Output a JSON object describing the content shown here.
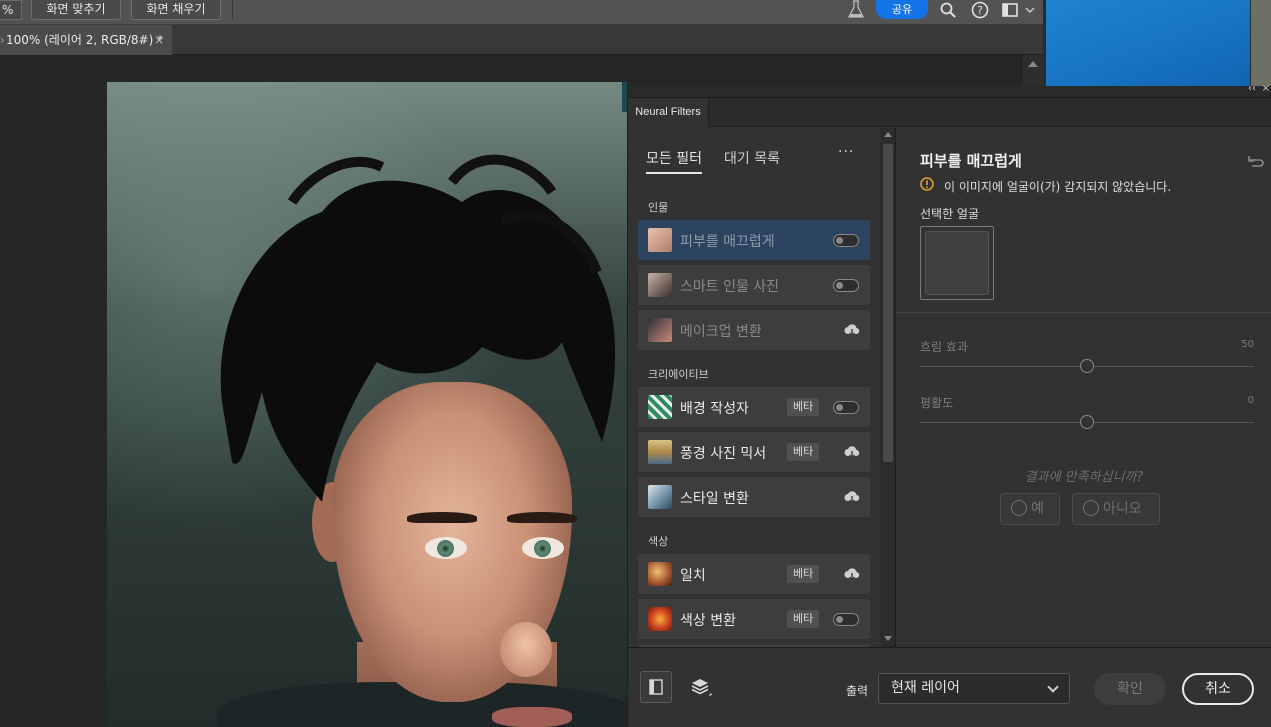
{
  "options_bar": {
    "zoom_fragment": "%",
    "fit_screen_label": "화면 맞추기",
    "fill_screen_label": "화면 채우기",
    "share_label": "공유"
  },
  "document": {
    "tab_title": "100% (레이어 2, RGB/8#) *",
    "close_glyph": "×"
  },
  "panel": {
    "tab_title": "Neural Filters",
    "collapse_glyph": "‹‹",
    "close_glyph": "×",
    "tabs": {
      "all_filters": "모든 필터",
      "waitlist": "대기 목록",
      "more": "···"
    },
    "categories": [
      {
        "name": "인물",
        "filters": [
          {
            "label": "피부를 매끄럽게",
            "beta": "",
            "control": "toggle",
            "selected": true,
            "thumb": "#d9a99a"
          },
          {
            "label": "스마트 인물 사진",
            "beta": "",
            "control": "toggle",
            "selected": false,
            "thumb": "#6b5a52"
          },
          {
            "label": "메이크업 변환",
            "beta": "",
            "control": "cloud",
            "selected": false,
            "thumb": "#7a4a5a"
          }
        ]
      },
      {
        "name": "크리에이티브",
        "filters": [
          {
            "label": "배경 작성자",
            "beta": "베타",
            "control": "toggle",
            "selected": false,
            "thumb": "#3f8f6a"
          },
          {
            "label": "풍경 사진 믹서",
            "beta": "베타",
            "control": "cloud",
            "selected": false,
            "thumb": "#8a7a4a"
          },
          {
            "label": "스타일 변환",
            "beta": "",
            "control": "cloud",
            "selected": false,
            "thumb": "#6a8aa0"
          }
        ]
      },
      {
        "name": "색상",
        "filters": [
          {
            "label": "일치",
            "beta": "베타",
            "control": "cloud",
            "selected": false,
            "thumb": "#a0622e"
          },
          {
            "label": "색상 변환",
            "beta": "베타",
            "control": "toggle",
            "selected": false,
            "thumb": "#c0502a"
          }
        ]
      }
    ],
    "settings": {
      "title": "피부를 매끄럽게",
      "warning": "이 이미지에 얼굴이(가) 감지되지 않았습니다.",
      "selected_face_label": "선택한 얼굴",
      "sliders": [
        {
          "label": "흐림 효과",
          "value": "50",
          "fraction": 0.5
        },
        {
          "label": "평활도",
          "value": "0",
          "fraction": 0.5
        }
      ],
      "feedback_question": "결과에 만족하십니까?",
      "yes_label": "예",
      "no_label": "아니오"
    },
    "footer": {
      "output_label": "출력",
      "output_value": "현재 레이어",
      "ok_label": "확인",
      "cancel_label": "취소"
    }
  }
}
